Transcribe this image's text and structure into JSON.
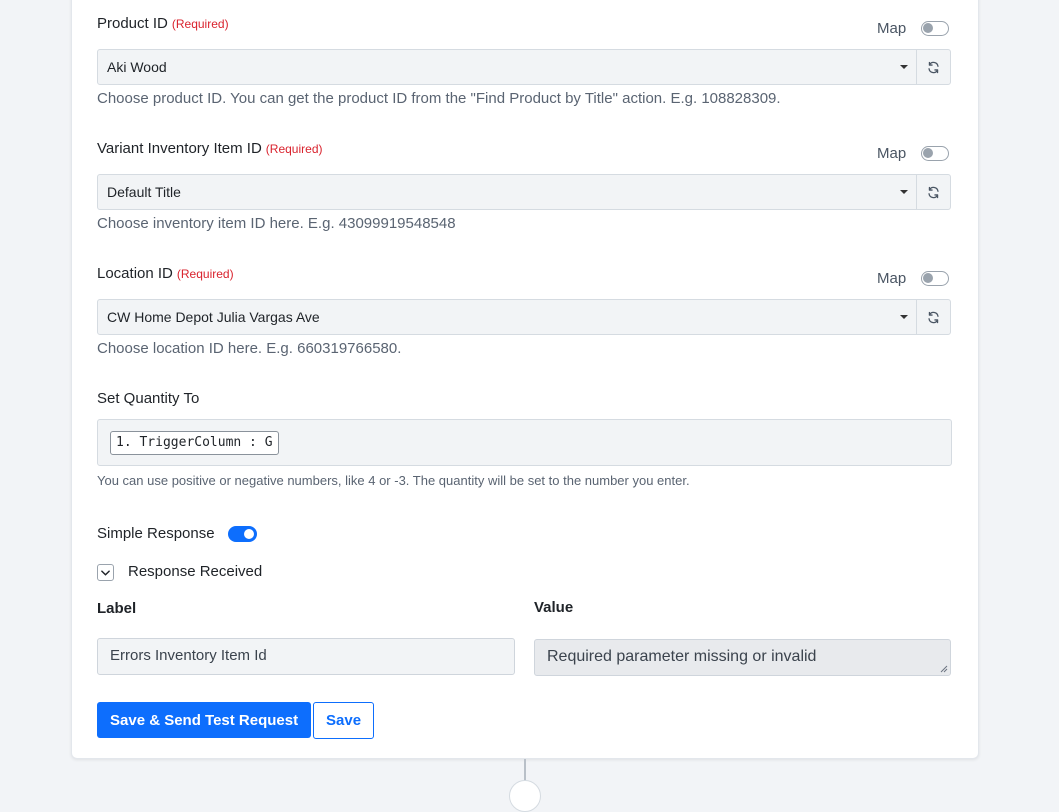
{
  "fields": [
    {
      "label": "Product ID",
      "required": "(Required)",
      "map_label": "Map",
      "value": "Aki Wood",
      "help": "Choose product ID. You can get the product ID from the \"Find Product by Title\" action. E.g. 108828309."
    },
    {
      "label": "Variant Inventory Item ID",
      "required": "(Required)",
      "map_label": "Map",
      "value": "Default Title",
      "help": "Choose inventory item ID here. E.g. 43099919548548"
    },
    {
      "label": "Location ID",
      "required": "(Required)",
      "map_label": "Map",
      "value": "CW Home Depot Julia Vargas Ave",
      "help": "Choose location ID here. E.g. 660319766580."
    }
  ],
  "quantity": {
    "label": "Set Quantity To",
    "token": "1. TriggerColumn : G",
    "help": "You can use positive or negative numbers, like 4 or -3. The quantity will be set to the number you enter."
  },
  "simple_response": {
    "label": "Simple Response",
    "enabled": true
  },
  "response_received": {
    "label": "Response Received",
    "label_header": "Label",
    "value_header": "Value",
    "row_label": "Errors Inventory Item Id",
    "row_value": "Required parameter missing or invalid"
  },
  "actions": {
    "save_test_label": "Save & Send Test Request",
    "save_label": "Save"
  },
  "colors": {
    "accent": "#0d6efd",
    "required": "#d9232e"
  }
}
